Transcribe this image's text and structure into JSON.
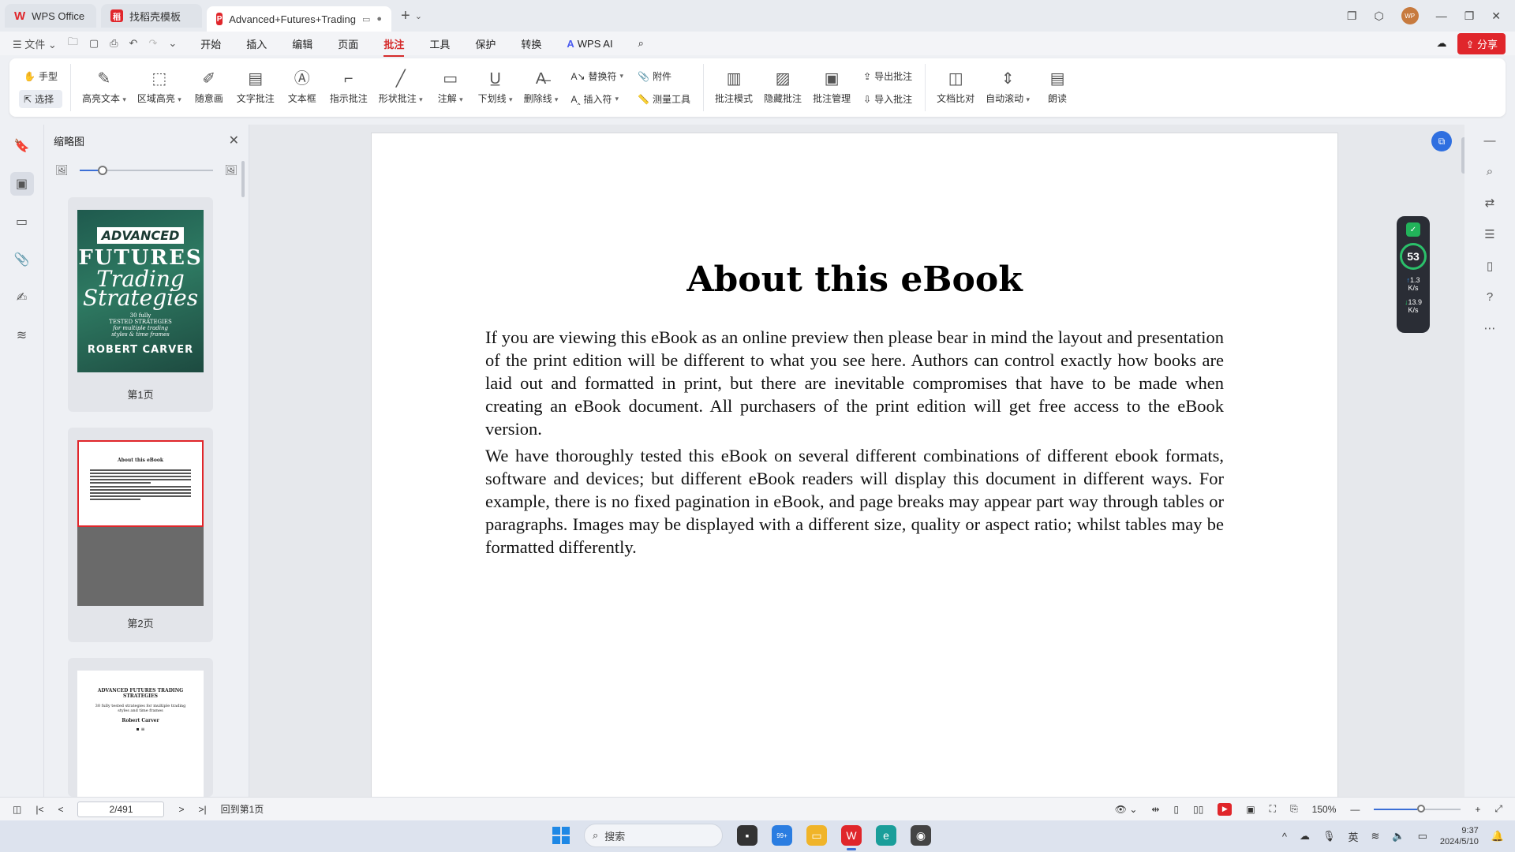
{
  "tabs": {
    "home": "WPS Office",
    "templates": "找稻壳模板",
    "document": "Advanced+Futures+Trading"
  },
  "menubar": {
    "file": "文件",
    "menus": [
      "开始",
      "插入",
      "编辑",
      "页面",
      "批注",
      "工具",
      "保护",
      "转换"
    ],
    "active_menu": "批注",
    "wps_ai": "WPS AI",
    "share": "分享"
  },
  "ribbon": {
    "hand": "手型",
    "select": "选择",
    "highlight_text": "高亮文本",
    "area_highlight": "区域高亮",
    "freehand": "随意画",
    "text_comment": "文字批注",
    "text_box": "文本框",
    "pointer_comment": "指示批注",
    "shape_comment": "形状批注",
    "note": "注解",
    "underline": "下划线",
    "strikethrough": "删除线",
    "replace": "替换符",
    "insert": "插入符",
    "attachment": "附件",
    "measure": "测量工具",
    "comment_mode": "批注模式",
    "hide_comments": "隐藏批注",
    "comment_manage": "批注管理",
    "export_comments": "导出批注",
    "import_comments": "导入批注",
    "compare": "文档比对",
    "auto_scroll": "自动滚动",
    "read_aloud": "朗读"
  },
  "thumbnails": {
    "title": "缩略图",
    "page1_label": "第1页",
    "page2_label": "第2页",
    "cover": {
      "advanced": "ADVANCED",
      "futures": "FUTURES",
      "trading": "Trading",
      "strategies": "Strategies",
      "tagline1": "30 fully",
      "tagline2": "TESTED STRATEGIES",
      "tagline3": "for multiple trading",
      "tagline4": "styles & time frames",
      "author": "ROBERT CARVER"
    },
    "page2_title": "About this eBook",
    "page3": {
      "title": "ADVANCED FUTURES TRADING STRATEGIES",
      "subtitle": "30 fully tested strategies for multiple trading styles and time frames",
      "author": "Robert Carver"
    }
  },
  "document": {
    "title": "About this eBook",
    "paragraph1": "If you are viewing this eBook as an online preview then please bear in mind the layout and presentation of the print edition will be different to what you see here. Authors can control exactly how books are laid out and formatted in print, but there are inevitable compromises that have to be made when creating an eBook document. All purchasers of the print edition will get free access to the eBook version.",
    "paragraph2": "We have thoroughly tested this eBook on several different combinations of different ebook formats, software and devices; but different eBook readers will display this document in different ways. For example, there is no fixed pagination in eBook, and page breaks may appear part way through tables or paragraphs. Images may be displayed with a different size, quality or aspect ratio; whilst tables may be formatted differently."
  },
  "speed_widget": {
    "percent": "53",
    "upload": "1.3",
    "upload_unit": "K/s",
    "download": "13.9",
    "download_unit": "K/s"
  },
  "statusbar": {
    "page": "2/491",
    "back_to_first": "回到第1页",
    "zoom": "150%"
  },
  "taskbar": {
    "search": "搜索",
    "ime": "英",
    "time": "9:37",
    "date": "2024/5/10",
    "badge": "99+"
  },
  "colors": {
    "accent_red": "#e0262b",
    "blue": "#3b6fd6"
  }
}
